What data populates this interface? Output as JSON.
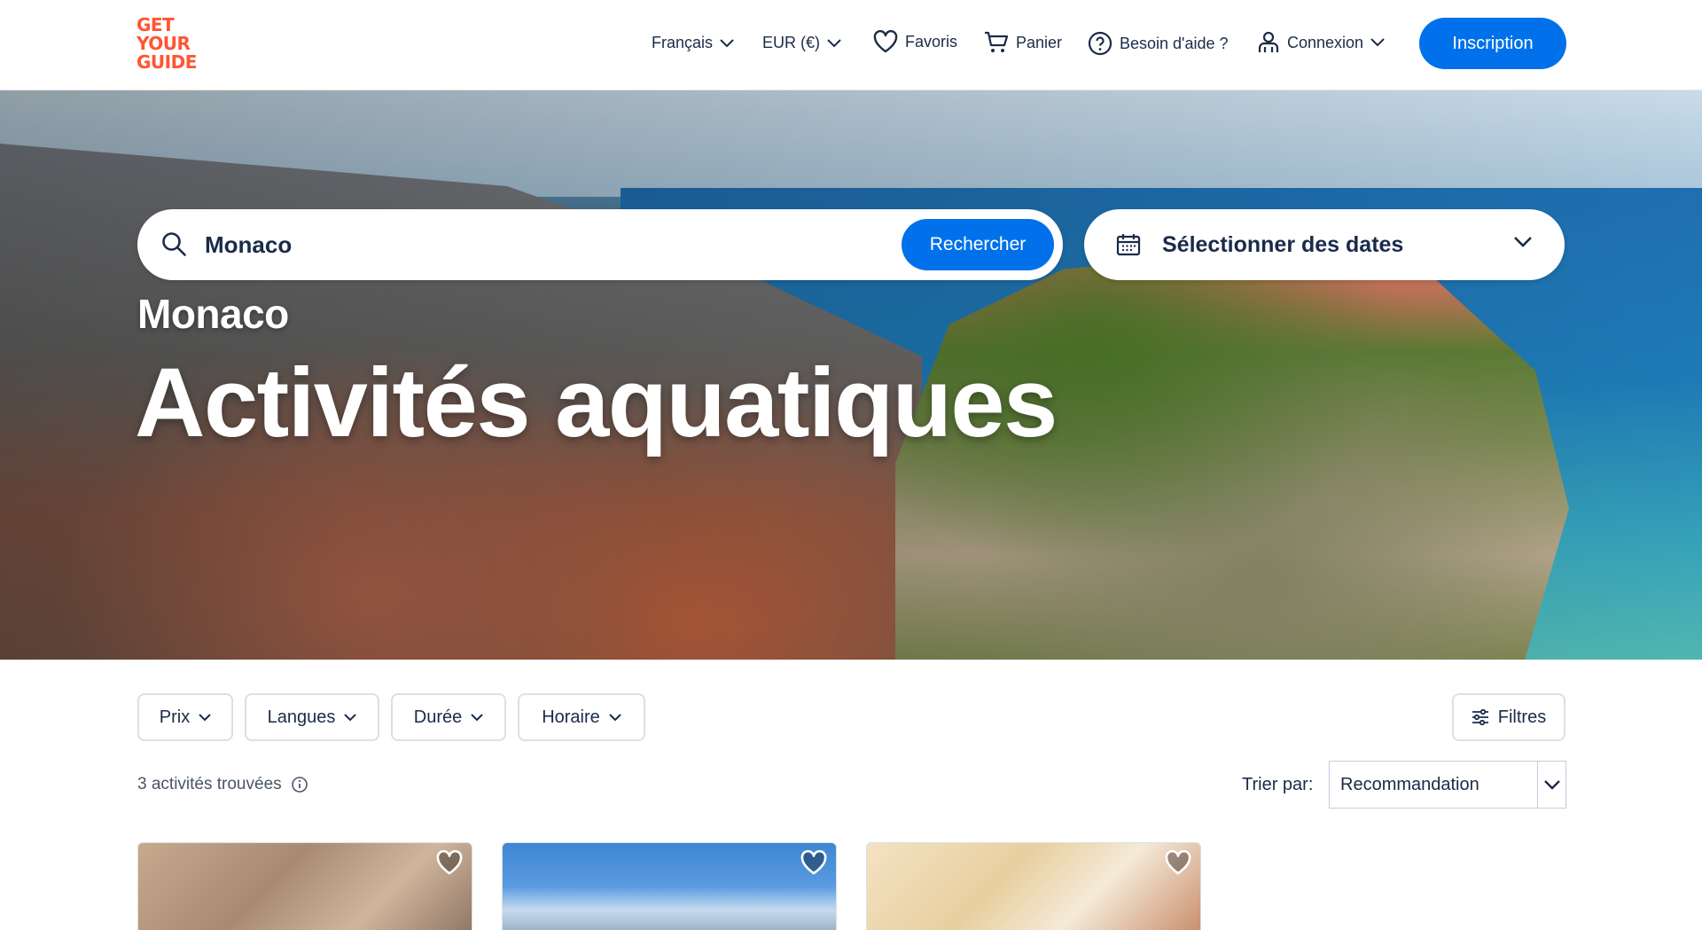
{
  "header": {
    "logo_lines": [
      "GET",
      "YOUR",
      "GUIDE"
    ],
    "nav": {
      "language": "Français",
      "currency": "EUR (€)",
      "favorites": "Favoris",
      "cart": "Panier",
      "help": "Besoin d'aide ?",
      "login": "Connexion",
      "signup": "Inscription"
    }
  },
  "search": {
    "value": "Monaco",
    "button": "Rechercher",
    "date_label": "Sélectionner des dates"
  },
  "hero": {
    "location": "Monaco",
    "title": "Activités aquatiques"
  },
  "filters": {
    "price": "Prix",
    "languages": "Langues",
    "duration": "Durée",
    "time": "Horaire",
    "all_filters": "Filtres"
  },
  "results": {
    "count_text": "3 activités trouvées",
    "sort_label": "Trier par:",
    "sort_value": "Recommandation"
  },
  "icons": [
    "chevron-down-icon",
    "heart-icon",
    "cart-icon",
    "help-icon",
    "user-icon",
    "search-icon",
    "calendar-icon",
    "info-icon",
    "sliders-icon"
  ],
  "colors": {
    "brand_orange": "#ff5533",
    "primary_blue": "#0071eb",
    "text_dark": "#1a2b49"
  }
}
